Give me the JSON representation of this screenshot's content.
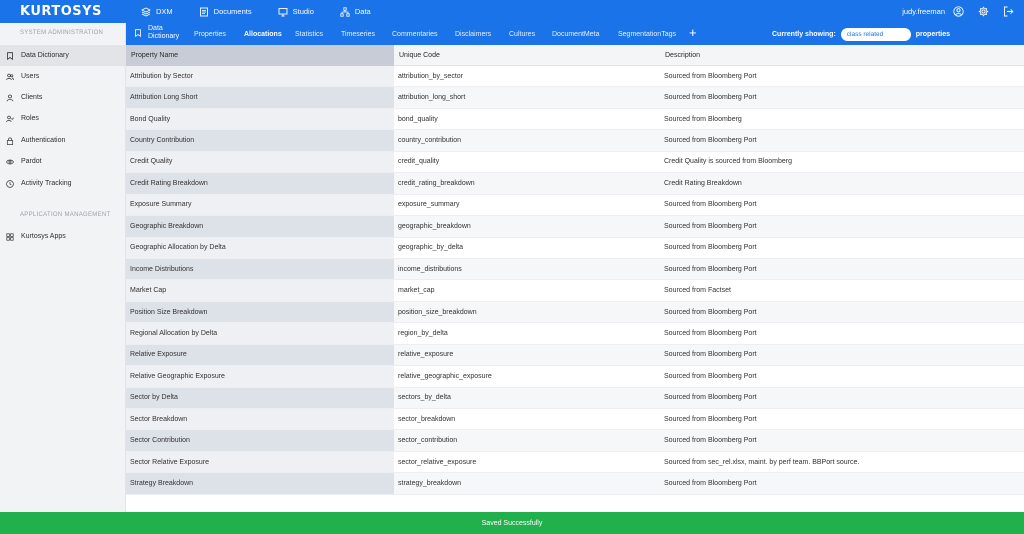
{
  "brand": {
    "logo": "KURTOSYS"
  },
  "topnav": [
    {
      "label": "DXM",
      "icon": "layers-icon"
    },
    {
      "label": "Documents",
      "icon": "document-icon"
    },
    {
      "label": "Studio",
      "icon": "monitor-icon"
    },
    {
      "label": "Data",
      "icon": "hierarchy-icon"
    }
  ],
  "user": {
    "name": "judy.freeman"
  },
  "sidebar": {
    "section1": "SYSTEM ADMINISTRATION",
    "items": [
      {
        "label": "Data Dictionary",
        "icon": "bookmark-icon"
      },
      {
        "label": "Users",
        "icon": "users-icon"
      },
      {
        "label": "Clients",
        "icon": "user-icon"
      },
      {
        "label": "Roles",
        "icon": "user-check-icon"
      },
      {
        "label": "Authentication",
        "icon": "lock-icon"
      },
      {
        "label": "Pardot",
        "icon": "eye-icon"
      },
      {
        "label": "Activity Tracking",
        "icon": "clock-icon"
      }
    ],
    "section2": "APPLICATION MANAGEMENT",
    "items2": [
      {
        "label": "Kurtosys Apps",
        "icon": "grid-icon"
      }
    ]
  },
  "subnav": {
    "dictionary_line1": "Data",
    "dictionary_line2": "Dictionary",
    "tabs": [
      "Properties",
      "Allocations",
      "Statistics",
      "Timeseries",
      "Commentaries",
      "Disclaimers",
      "Cultures",
      "DocumentMeta",
      "SegmentationTags"
    ],
    "active_tab": "Allocations",
    "showing_label": "Currently showing:",
    "showing_value": "class related",
    "showing_suffix": "properties"
  },
  "table": {
    "headers": [
      "Property Name",
      "Unique Code",
      "Description"
    ],
    "rows": [
      [
        "Attribution by Sector",
        "attribution_by_sector",
        "Sourced from Bloomberg Port"
      ],
      [
        "Attribution Long Short",
        "attribution_long_short",
        "Sourced from Bloomberg Port"
      ],
      [
        "Bond Quality",
        "bond_quality",
        "Sourced from Bloomberg"
      ],
      [
        "Country Contribution",
        "country_contribution",
        "Sourced from Bloomberg Port"
      ],
      [
        "Credit Quality",
        "credit_quality",
        "Credit Quality is sourced from Bloomberg"
      ],
      [
        "Credit Rating Breakdown",
        "credit_rating_breakdown",
        "Credit Rating Breakdown"
      ],
      [
        "Exposure Summary",
        "exposure_summary",
        "Sourced from Bloomberg Port"
      ],
      [
        "Geographic Breakdown",
        "geographic_breakdown",
        "Sourced from Bloomberg Port"
      ],
      [
        "Geographic Allocation by Delta",
        "geographic_by_delta",
        "Sourced from Bloomberg Port"
      ],
      [
        "Income Distributions",
        "income_distributions",
        "Sourced from Bloomberg Port"
      ],
      [
        "Market Cap",
        "market_cap",
        "Sourced from Factset"
      ],
      [
        "Position Size Breakdown",
        "position_size_breakdown",
        "Sourced from Bloomberg Port"
      ],
      [
        "Regional Allocation by Delta",
        "region_by_delta",
        "Sourced from Bloomberg Port"
      ],
      [
        "Relative Exposure",
        "relative_exposure",
        "Sourced from Bloomberg Port"
      ],
      [
        "Relative Geographic Exposure",
        "relative_geographic_exposure",
        "Sourced from Bloomberg Port"
      ],
      [
        "Sector by Delta",
        "sectors_by_delta",
        "Sourced from Bloomberg Port"
      ],
      [
        "Sector Breakdown",
        "sector_breakdown",
        "Sourced from Bloomberg Port"
      ],
      [
        "Sector Contribution",
        "sector_contribution",
        "Sourced from Bloomberg Port"
      ],
      [
        "Sector Relative Exposure",
        "sector_relative_exposure",
        "Sourced from sec_rel.xlsx, maint. by perf team. BBPort source."
      ],
      [
        "Strategy Breakdown",
        "strategy_breakdown",
        "Sourced from Bloomberg Port"
      ]
    ]
  },
  "toast": {
    "message": "Saved Successfully"
  },
  "colors": {
    "primary": "#1a73e8",
    "success": "#21b04b",
    "sidebar": "#f2f3f5"
  }
}
